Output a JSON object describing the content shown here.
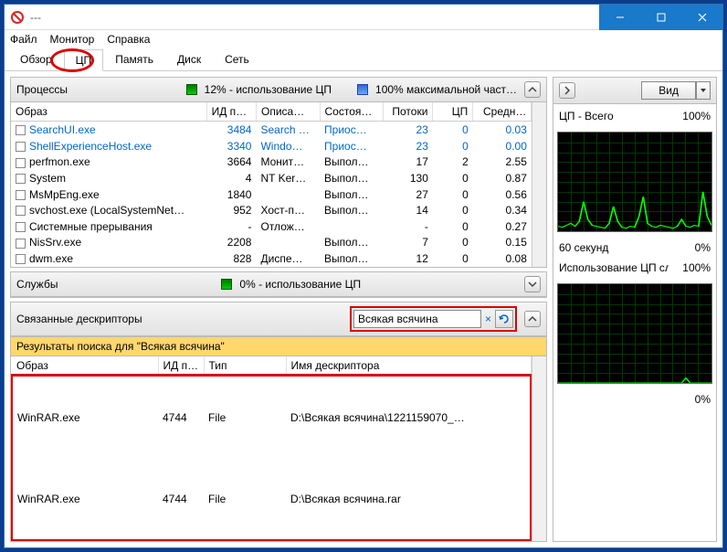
{
  "window": {
    "title": "---"
  },
  "menu": {
    "file": "Файл",
    "monitor": "Монитор",
    "help": "Справка"
  },
  "tabs": {
    "overview": "Обзор",
    "cpu": "ЦП",
    "memory": "Память",
    "disk": "Диск",
    "network": "Сеть"
  },
  "processes": {
    "title": "Процессы",
    "cpu_usage": "12% - использование ЦП",
    "max_freq": "100% максимальной част…",
    "cols": {
      "image": "Образ",
      "pid": "ИД п…",
      "desc": "Описа…",
      "state": "Состоя…",
      "threads": "Потоки",
      "cpu": "ЦП",
      "avg": "Средн…"
    },
    "rows": [
      {
        "blue": true,
        "image": "SearchUI.exe",
        "pid": "3484",
        "desc": "Search …",
        "state": "Приос…",
        "threads": "23",
        "cpu": "0",
        "avg": "0.03"
      },
      {
        "blue": true,
        "image": "ShellExperienceHost.exe",
        "pid": "3340",
        "desc": "Windo…",
        "state": "Приос…",
        "threads": "23",
        "cpu": "0",
        "avg": "0.00"
      },
      {
        "blue": false,
        "image": "perfmon.exe",
        "pid": "3664",
        "desc": "Монит…",
        "state": "Выпол…",
        "threads": "17",
        "cpu": "2",
        "avg": "2.55"
      },
      {
        "blue": false,
        "image": "System",
        "pid": "4",
        "desc": "NT Ker…",
        "state": "Выпол…",
        "threads": "130",
        "cpu": "0",
        "avg": "0.87"
      },
      {
        "blue": false,
        "image": "MsMpEng.exe",
        "pid": "1840",
        "desc": "",
        "state": "Выпол…",
        "threads": "27",
        "cpu": "0",
        "avg": "0.56"
      },
      {
        "blue": false,
        "image": "svchost.exe (LocalSystemNet…",
        "pid": "952",
        "desc": "Хост-п…",
        "state": "Выпол…",
        "threads": "14",
        "cpu": "0",
        "avg": "0.34"
      },
      {
        "blue": false,
        "image": "Системные прерывания",
        "pid": "-",
        "desc": "Отлож…",
        "state": "",
        "threads": "-",
        "cpu": "0",
        "avg": "0.27"
      },
      {
        "blue": false,
        "image": "NisSrv.exe",
        "pid": "2208",
        "desc": "",
        "state": "Выпол…",
        "threads": "7",
        "cpu": "0",
        "avg": "0.15"
      },
      {
        "blue": false,
        "image": "dwm.exe",
        "pid": "828",
        "desc": "Диспе…",
        "state": "Выпол…",
        "threads": "12",
        "cpu": "0",
        "avg": "0.08"
      }
    ]
  },
  "services": {
    "title": "Службы",
    "cpu_usage": "0% - использование ЦП"
  },
  "handles": {
    "title": "Связанные дескрипторы",
    "search_value": "Всякая всячина",
    "results_header": "Результаты поиска для \"Всякая всячина\"",
    "cols": {
      "image": "Образ",
      "pid": "ИД п…",
      "type": "Тип",
      "name": "Имя дескриптора"
    },
    "rows": [
      {
        "image": "WinRAR.exe",
        "pid": "4744",
        "type": "File",
        "name": "D:\\Всякая всячина\\1221159070_…"
      },
      {
        "image": "WinRAR.exe",
        "pid": "4744",
        "type": "File",
        "name": "D:\\Всякая всячина.rar"
      }
    ]
  },
  "right": {
    "view": "Вид",
    "graph1": {
      "title": "ЦП - Всего",
      "pct": "100%",
      "bottom_left": "60 секунд",
      "bottom_right": "0%"
    },
    "graph2": {
      "title": "Использование ЦП сл…",
      "pct": "100%",
      "bottom_right": "0%"
    }
  },
  "chart_data": [
    {
      "type": "line",
      "title": "ЦП - Всего",
      "xlabel": "60 секунд",
      "ylabel": "",
      "ylim": [
        0,
        100
      ],
      "x_seconds": 60,
      "values": [
        5,
        4,
        6,
        8,
        5,
        10,
        30,
        12,
        6,
        5,
        4,
        3,
        8,
        25,
        10,
        4,
        3,
        5,
        4,
        15,
        35,
        8,
        5,
        4,
        6,
        5,
        4,
        3,
        5,
        12,
        5,
        4,
        6,
        5,
        40,
        15,
        6
      ]
    },
    {
      "type": "line",
      "title": "Использование ЦП службами",
      "ylim": [
        0,
        100
      ],
      "x_seconds": 60,
      "values": [
        0,
        0,
        0,
        0,
        0,
        0,
        0,
        0,
        0,
        0,
        0,
        0,
        0,
        0,
        0,
        0,
        0,
        0,
        0,
        0,
        0,
        0,
        0,
        0,
        0,
        0,
        0,
        0,
        0,
        0,
        5,
        0,
        0,
        0,
        0,
        0,
        0
      ]
    }
  ]
}
